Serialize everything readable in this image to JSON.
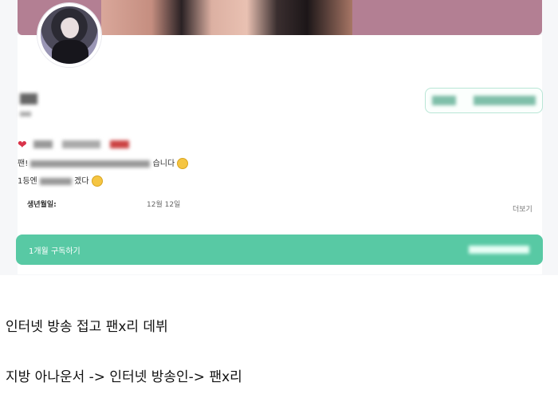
{
  "profile": {
    "bio_line2_prefix": "팬!",
    "bio_line2_suffix": "습니다",
    "bio_line3_prefix": "1등엔",
    "bio_line3_suffix": "겠다",
    "birthday_label": "생년월일:",
    "birthday_value": "12월 12일",
    "more_label": "더보기"
  },
  "subscribe": {
    "label": "1개월 구독하기"
  },
  "captions": {
    "line1": "인터넷 방송 접고 팬x리 데뷔",
    "line2": "지방 아나운서 -> 인터넷 방송인-> 팬x리"
  },
  "colors": {
    "accent": "#58c9a4",
    "cover": "#b37f93",
    "heart": "#d9344a"
  }
}
